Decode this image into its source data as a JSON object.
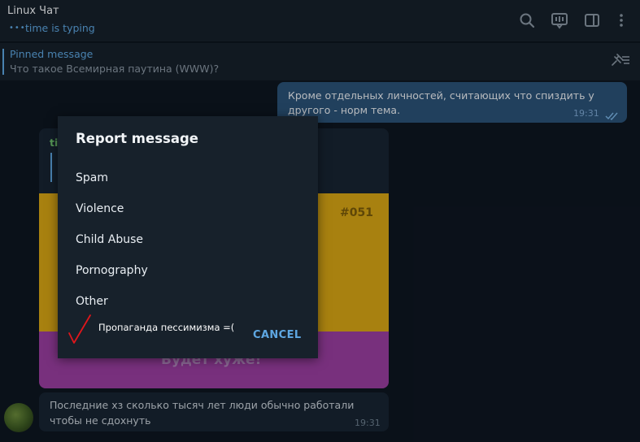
{
  "header": {
    "chat_title": "Linux Чат",
    "typing_dots": "•••",
    "typing_status": "time is typing",
    "icons": [
      "search-icon",
      "video-chat-icon",
      "sidebar-toggle-icon",
      "more-vert-icon"
    ]
  },
  "pinned": {
    "title": "Pinned message",
    "text": "Что такое Всемирная паутина (WWW)?"
  },
  "messages": {
    "outgoing": {
      "text": "Кроме отдельных личностей, считающих что спиздить у другого - норм тема.",
      "time": "19:31"
    },
    "media": {
      "sender": "ti",
      "tag": "#051",
      "caption": "Будет хуже!"
    },
    "incoming": {
      "text": "Последние хз сколько тысяч лет люди обычно работали чтобы не сдохнуть",
      "time": "19:31"
    }
  },
  "dialog": {
    "title": "Report message",
    "options": [
      "Spam",
      "Violence",
      "Child Abuse",
      "Pornography",
      "Other"
    ],
    "custom_option": "Пропаганда пессимизма =(",
    "cancel_label": "CANCEL"
  },
  "colors": {
    "accent": "#5ea7e2",
    "background": "#0e1621",
    "panel": "#17212b",
    "outgoing_bubble": "#2b5278"
  }
}
